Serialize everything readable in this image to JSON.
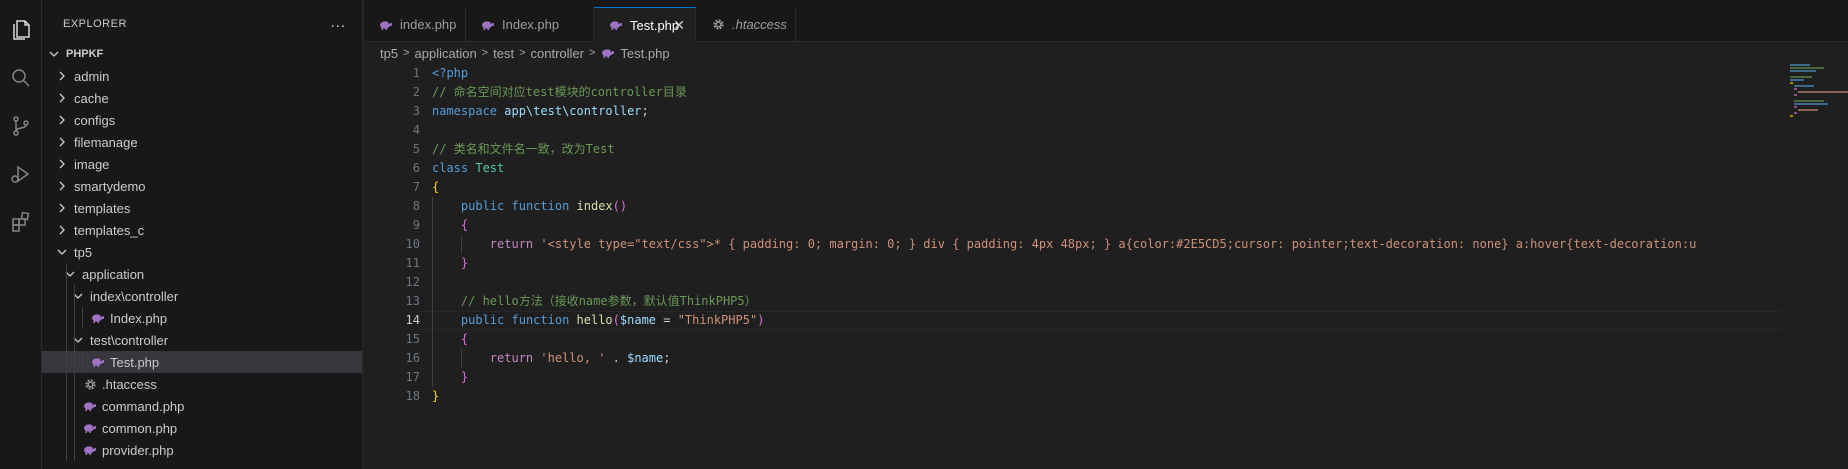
{
  "explorer": {
    "title": "EXPLORER",
    "more": "...",
    "root": "PHPKF",
    "items": [
      {
        "label": "admin",
        "type": "folder",
        "expanded": false,
        "depth": 1
      },
      {
        "label": "cache",
        "type": "folder",
        "expanded": false,
        "depth": 1
      },
      {
        "label": "configs",
        "type": "folder",
        "expanded": false,
        "depth": 1
      },
      {
        "label": "filemanage",
        "type": "folder",
        "expanded": false,
        "depth": 1
      },
      {
        "label": "image",
        "type": "folder",
        "expanded": false,
        "depth": 1
      },
      {
        "label": "smartydemo",
        "type": "folder",
        "expanded": false,
        "depth": 1
      },
      {
        "label": "templates",
        "type": "folder",
        "expanded": false,
        "depth": 1
      },
      {
        "label": "templates_c",
        "type": "folder",
        "expanded": false,
        "depth": 1
      },
      {
        "label": "tp5",
        "type": "folder",
        "expanded": true,
        "depth": 1
      },
      {
        "label": "application",
        "type": "folder",
        "expanded": true,
        "depth": 2
      },
      {
        "label": "index\\controller",
        "type": "folder",
        "expanded": true,
        "depth": 3
      },
      {
        "label": "Index.php",
        "type": "php",
        "depth": 4
      },
      {
        "label": "test\\controller",
        "type": "folder",
        "expanded": true,
        "depth": 3
      },
      {
        "label": "Test.php",
        "type": "php",
        "depth": 4,
        "selected": true
      },
      {
        "label": ".htaccess",
        "type": "gear",
        "depth": 3
      },
      {
        "label": "command.php",
        "type": "php",
        "depth": 3
      },
      {
        "label": "common.php",
        "type": "php",
        "depth": 3
      },
      {
        "label": "provider.php",
        "type": "php",
        "depth": 3
      }
    ]
  },
  "tabs": [
    {
      "label": "index.php",
      "icon": "php-icon",
      "active": false
    },
    {
      "label": "Index.php",
      "icon": "php-icon",
      "active": false
    },
    {
      "label": "Test.php",
      "icon": "php-icon",
      "active": true,
      "close": "✕"
    },
    {
      "label": ".htaccess",
      "icon": "gear-icon",
      "active": false,
      "italic": true
    }
  ],
  "breadcrumb": {
    "parts": [
      "tp5",
      "application",
      "test",
      "controller"
    ],
    "file": "Test.php"
  },
  "editor": {
    "current_line": 14,
    "line_numbers": [
      "1",
      "2",
      "3",
      "4",
      "5",
      "6",
      "7",
      "8",
      "9",
      "10",
      "11",
      "12",
      "13",
      "14",
      "15",
      "16",
      "17",
      "18"
    ],
    "lines": [
      [
        {
          "c": "tk-php",
          "t": "<?php"
        }
      ],
      [
        {
          "c": "tk-cm",
          "t": "// 命名空间对应test模块的controller目录"
        }
      ],
      [
        {
          "c": "tk-kw",
          "t": "namespace"
        },
        {
          "c": "",
          "t": " "
        },
        {
          "c": "tk-var",
          "t": "app\\test\\controller"
        },
        {
          "c": "",
          "t": ";"
        }
      ],
      [],
      [
        {
          "c": "tk-cm",
          "t": "// 类名和文件名一致，改为Test"
        }
      ],
      [
        {
          "c": "tk-kw",
          "t": "class"
        },
        {
          "c": "",
          "t": " "
        },
        {
          "c": "tk-cls",
          "t": "Test"
        }
      ],
      [
        {
          "c": "tk-br",
          "t": "{"
        }
      ],
      [
        {
          "c": "",
          "t": "    "
        },
        {
          "c": "tk-kw",
          "t": "public"
        },
        {
          "c": "",
          "t": " "
        },
        {
          "c": "tk-kw",
          "t": "function"
        },
        {
          "c": "",
          "t": " "
        },
        {
          "c": "tk-fn",
          "t": "index"
        },
        {
          "c": "tk-br2",
          "t": "()"
        }
      ],
      [
        {
          "c": "",
          "t": "    "
        },
        {
          "c": "tk-br2",
          "t": "{"
        }
      ],
      [
        {
          "c": "",
          "t": "        "
        },
        {
          "c": "tk-ctl",
          "t": "return"
        },
        {
          "c": "",
          "t": " "
        },
        {
          "c": "tk-str",
          "t": "'<style type=\"text/css\">* { padding: 0; margin: 0; } div { padding: 4px 48px; } a{color:#2E5CD5;cursor: pointer;text-decoration: none} a:hover{text-decoration:u"
        }
      ],
      [
        {
          "c": "",
          "t": "    "
        },
        {
          "c": "tk-br2",
          "t": "}"
        }
      ],
      [],
      [
        {
          "c": "",
          "t": "    "
        },
        {
          "c": "tk-cm",
          "t": "// hello方法（接收name参数，默认值ThinkPHP5）"
        }
      ],
      [
        {
          "c": "",
          "t": "    "
        },
        {
          "c": "tk-kw",
          "t": "public"
        },
        {
          "c": "",
          "t": " "
        },
        {
          "c": "tk-kw",
          "t": "function"
        },
        {
          "c": "",
          "t": " "
        },
        {
          "c": "tk-fn",
          "t": "hello"
        },
        {
          "c": "tk-br2",
          "t": "("
        },
        {
          "c": "tk-var",
          "t": "$name"
        },
        {
          "c": "",
          "t": " = "
        },
        {
          "c": "tk-str",
          "t": "\"ThinkPHP5\""
        },
        {
          "c": "tk-br2",
          "t": ")"
        }
      ],
      [
        {
          "c": "",
          "t": "    "
        },
        {
          "c": "tk-br2",
          "t": "{"
        }
      ],
      [
        {
          "c": "",
          "t": "        "
        },
        {
          "c": "tk-ctl",
          "t": "return"
        },
        {
          "c": "",
          "t": " "
        },
        {
          "c": "tk-str",
          "t": "'hello, '"
        },
        {
          "c": "",
          "t": " . "
        },
        {
          "c": "tk-var",
          "t": "$name"
        },
        {
          "c": "",
          "t": ";"
        }
      ],
      [
        {
          "c": "",
          "t": "    "
        },
        {
          "c": "tk-br2",
          "t": "}"
        }
      ],
      [
        {
          "c": "tk-br",
          "t": "}"
        }
      ]
    ]
  },
  "colors": {
    "accent": "#0078d4",
    "php_icon": "#a074c4",
    "folder_text": "#cccccc"
  }
}
